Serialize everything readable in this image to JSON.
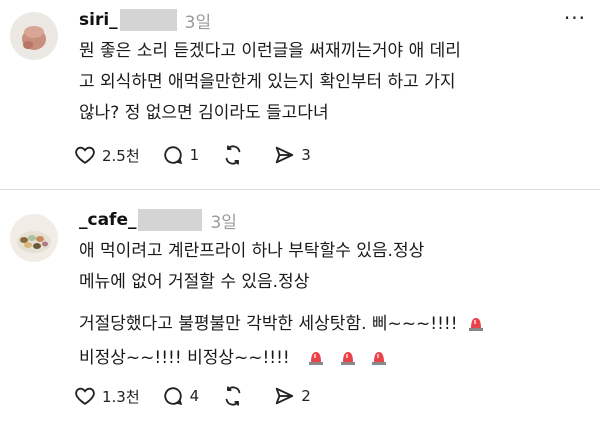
{
  "posts": [
    {
      "username": "siri_",
      "time": "3일",
      "lines": [
        "뭔 좋은 소리 듣겠다고 이런글을 써재끼는거야 애 데리",
        "고 외식하면 애먹을만한게 있는지 확인부터 하고 가지",
        "않나? 정 없으면 김이라도 들고다녀"
      ],
      "likes": "2.5천",
      "comments": "1",
      "shares": "3"
    },
    {
      "username": "_cafe_",
      "time": "3일",
      "lines": [
        "애 먹이려고 계란프라이 하나 부탁할수 있음.정상",
        "메뉴에 없어 거절할 수 있음.정상"
      ],
      "lines2": [
        "거절당했다고 불평불만 각박한 세상탓함. 삐~~~!!!!",
        "비정상~~!!!! 비정상~~!!!!"
      ],
      "likes": "1.3천",
      "comments": "4",
      "shares": "2"
    }
  ],
  "more_label": "···",
  "icons": [
    "heart-icon",
    "comment-icon",
    "repost-icon",
    "send-icon",
    "siren-emoji"
  ]
}
